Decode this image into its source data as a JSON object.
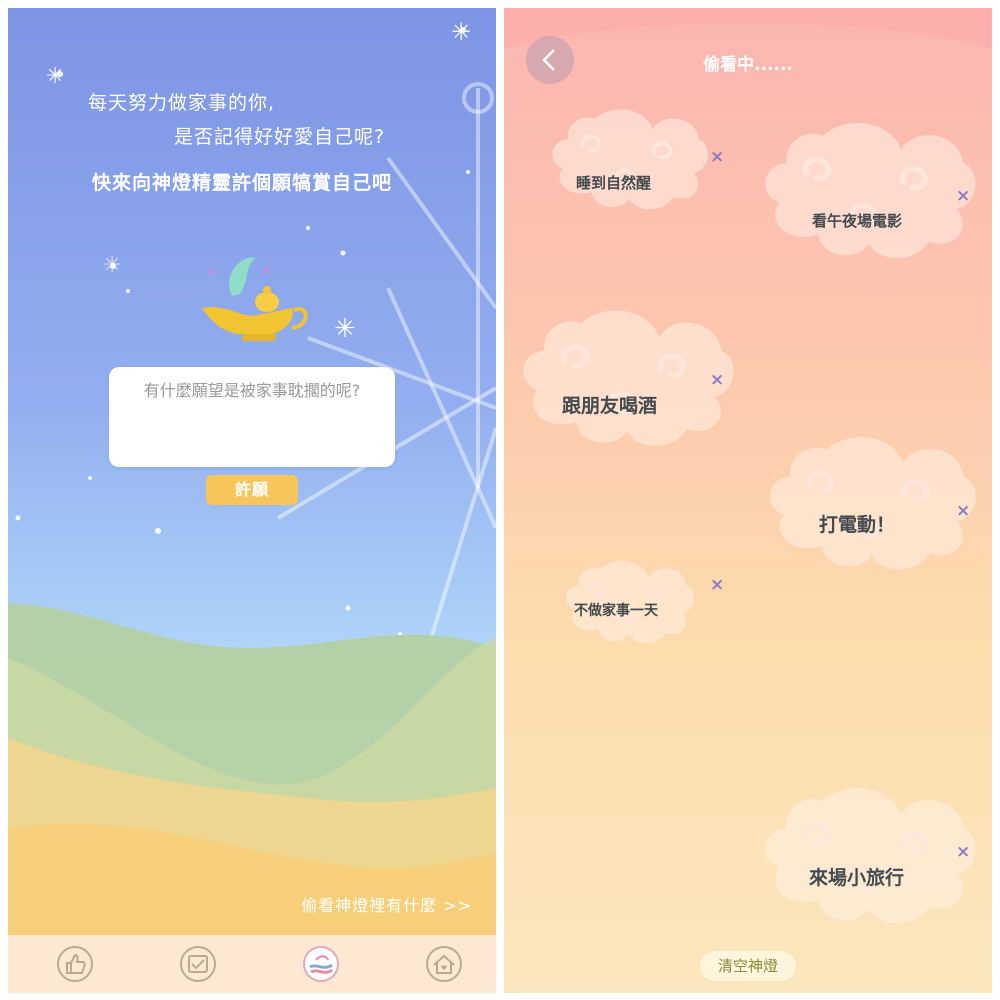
{
  "lamp_screen": {
    "intro_line1": "每天努力做家事的你,",
    "intro_line2": "是否記得好好愛自己呢?",
    "intro_line3": "快來向神燈精靈許個願犒賞自己吧",
    "wish_input": {
      "placeholder": "有什麼願望是被家事耽擱的呢?",
      "value": ""
    },
    "wish_button": "許願",
    "peek_link": "偷看神燈裡有什麼 >>",
    "tabs": [
      {
        "icon": "thumbs-up-icon"
      },
      {
        "icon": "calendar-check-icon"
      },
      {
        "icon": "genie-lamp-icon",
        "active": true
      },
      {
        "icon": "home-heart-icon"
      }
    ]
  },
  "peek_screen": {
    "title": "偷看中......",
    "wishes": [
      {
        "label": "睡到自然醒"
      },
      {
        "label": "看午夜場電影"
      },
      {
        "label": "跟朋友喝酒"
      },
      {
        "label": "打電動！"
      },
      {
        "label": "不做家事一天"
      },
      {
        "label": "來場小旅行"
      }
    ],
    "delete_symbol": "×",
    "clear_button": "清空神燈"
  },
  "colors": {
    "sky_top": "#7d94e4",
    "warm_top": "#fbb5b2",
    "button_yellow": "#f8c55a",
    "delete_purple": "#8d7bc4"
  }
}
